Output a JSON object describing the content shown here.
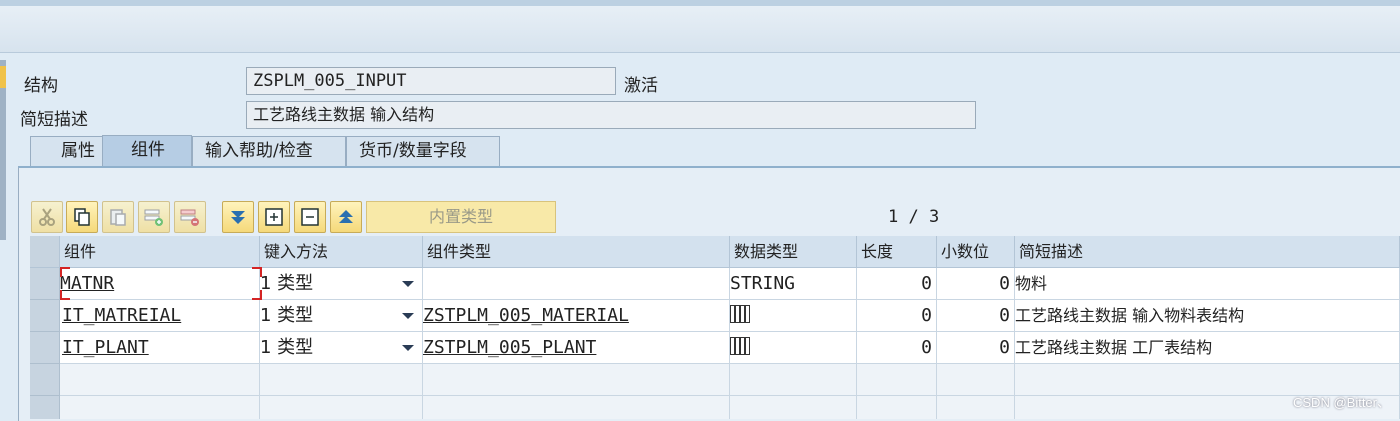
{
  "form": {
    "structure_label": "结构",
    "structure_value": "ZSPLM_005_INPUT",
    "status": "激活",
    "short_desc_label": "简短描述",
    "short_desc_value": "工艺路线主数据 输入结构"
  },
  "tabs": [
    {
      "label": "属性"
    },
    {
      "label": "组件"
    },
    {
      "label": "输入帮助/检查"
    },
    {
      "label": "货币/数量字段"
    }
  ],
  "toolbar": {
    "builtin_type_label": "内置类型",
    "pager": "1 / 3",
    "icons": [
      "cut-icon",
      "copy-icon",
      "paste-icon",
      "insert-row-icon",
      "delete-row-icon",
      "move-down-icon",
      "expand-icon",
      "collapse-icon",
      "move-up-icon"
    ]
  },
  "table": {
    "headers": [
      "组件",
      "键入方法",
      "组件类型",
      "数据类型",
      "长度",
      "小数位",
      "简短描述"
    ],
    "rows": [
      {
        "component": "MATNR",
        "entry": "1 类型",
        "comp_type": "",
        "data_type": "STRING",
        "length": "0",
        "decimals": "0",
        "desc": "物料"
      },
      {
        "component": "IT_MATREIAL",
        "entry": "1 类型",
        "comp_type": "ZSTPLM_005_MATERIAL",
        "data_type": "table-icon",
        "length": "0",
        "decimals": "0",
        "desc": "工艺路线主数据 输入物料表结构"
      },
      {
        "component": "IT_PLANT",
        "entry": "1 类型",
        "comp_type": "ZSTPLM_005_PLANT",
        "data_type": "table-icon",
        "length": "0",
        "decimals": "0",
        "desc": "工艺路线主数据 工厂表结构"
      }
    ]
  },
  "watermark": "CSDN @Bitter、"
}
